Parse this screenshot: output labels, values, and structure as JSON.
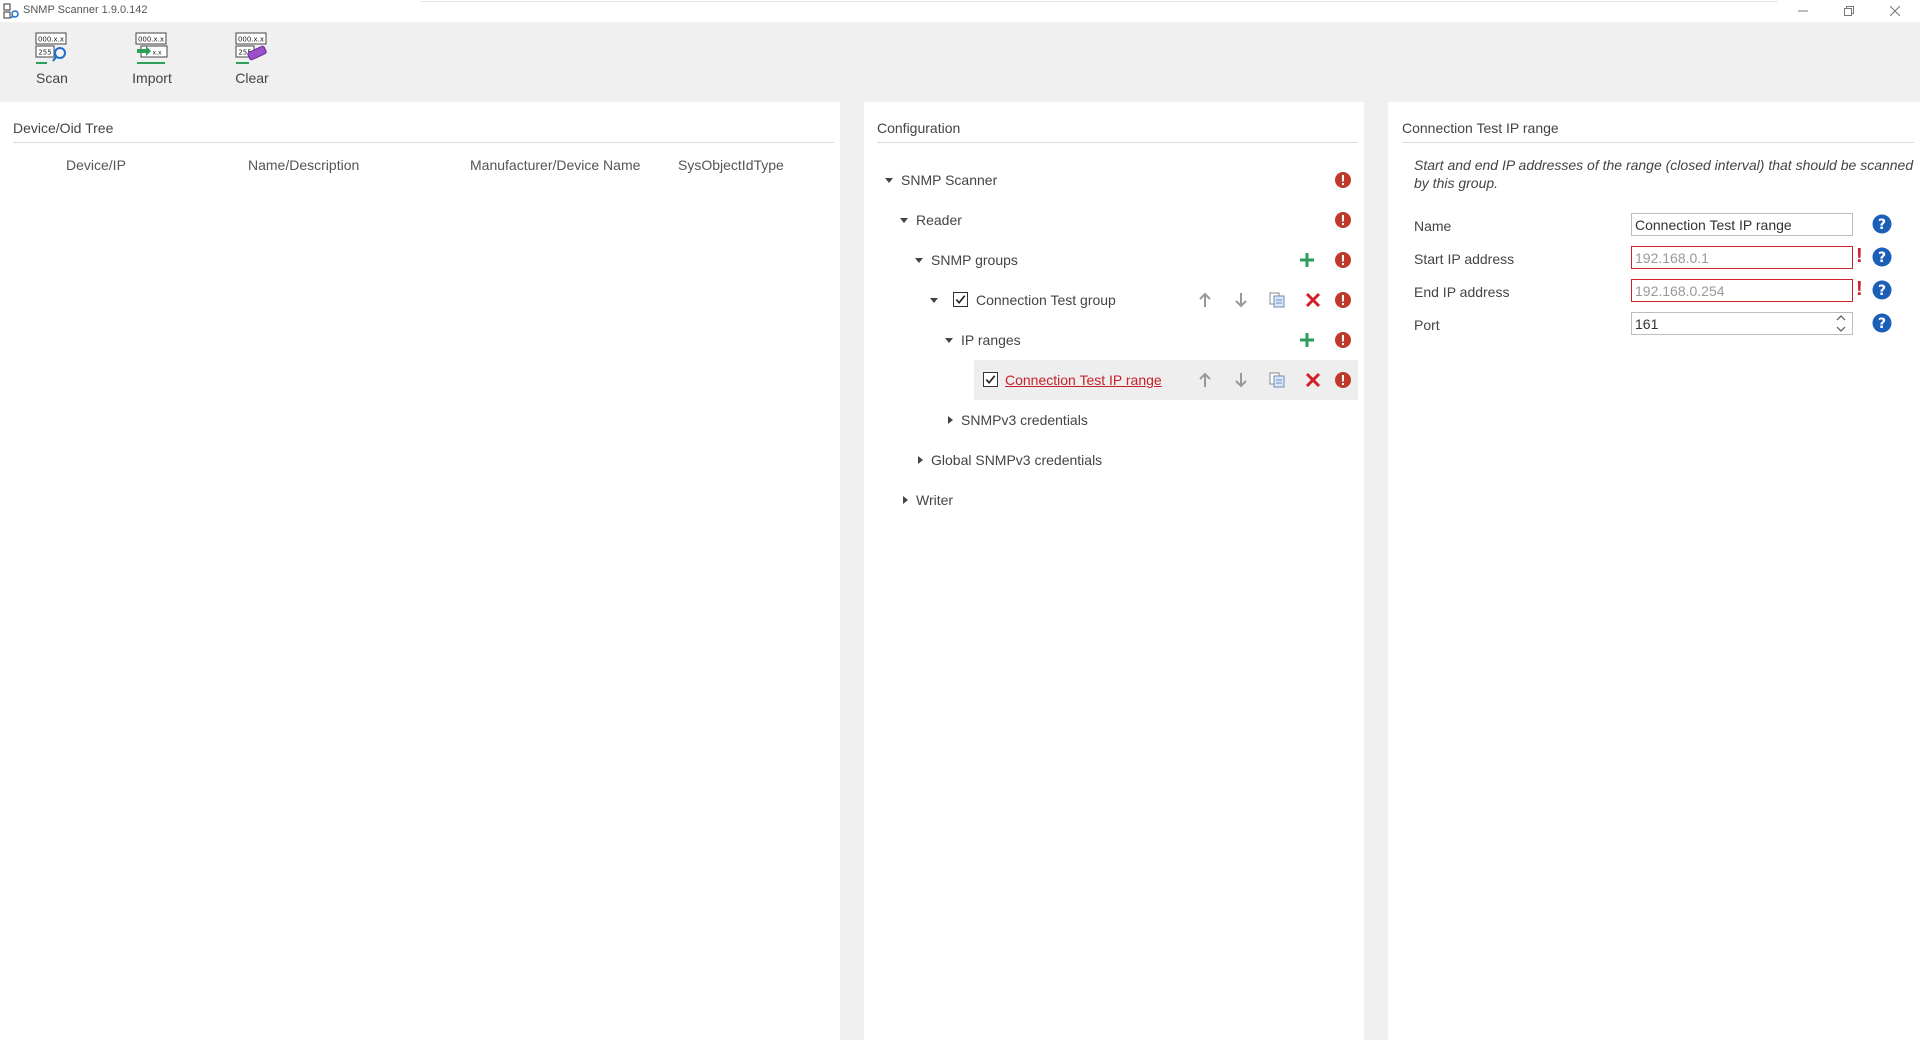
{
  "window": {
    "title": "SNMP Scanner 1.9.0.142"
  },
  "ribbon": {
    "buttons": [
      {
        "label": "Scan",
        "icon": "scan-icon"
      },
      {
        "label": "Import",
        "icon": "import-icon"
      },
      {
        "label": "Clear",
        "icon": "clear-icon"
      }
    ],
    "icon_text": {
      "top": "000.x.x",
      "bottom": "255"
    }
  },
  "device_tree": {
    "title": "Device/Oid Tree",
    "columns": [
      "Device/IP",
      "Name/Description",
      "Manufacturer/Device Name",
      "SysObjectIdType"
    ]
  },
  "configuration": {
    "title": "Configuration",
    "nodes": [
      {
        "label": "SNMP Scanner",
        "expanded": true
      },
      {
        "label": "Reader",
        "expanded": true
      },
      {
        "label": "SNMP groups",
        "expanded": true
      },
      {
        "label": "Connection Test group",
        "expanded": true,
        "checked": true
      },
      {
        "label": "IP ranges",
        "expanded": true
      },
      {
        "label": "Connection Test IP range",
        "checked": true,
        "selected": true
      },
      {
        "label": "SNMPv3 credentials",
        "expanded": false
      },
      {
        "label": "Global SNMPv3 credentials",
        "expanded": false
      },
      {
        "label": "Writer",
        "expanded": false
      }
    ],
    "colors": {
      "error": "#c0392b",
      "add": "#2e9e5b",
      "delete": "#d0202a",
      "link": "#c8202a"
    }
  },
  "properties": {
    "title": "Connection Test IP range",
    "description": "Start and end IP addresses of the range (closed interval) that should be scanned by this group.",
    "fields": {
      "name": {
        "label": "Name",
        "value": "Connection Test IP range"
      },
      "start_ip": {
        "label": "Start IP address",
        "value": "192.168.0.1",
        "invalid_marker": "!"
      },
      "end_ip": {
        "label": "End IP address",
        "value": "192.168.0.254",
        "invalid_marker": "!"
      },
      "port": {
        "label": "Port",
        "value": "161"
      }
    }
  }
}
